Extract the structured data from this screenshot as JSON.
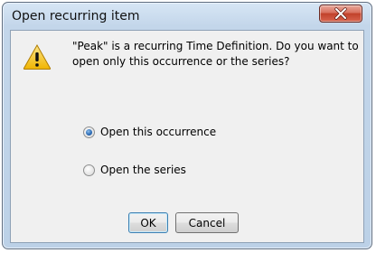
{
  "dialog": {
    "title": "Open recurring item",
    "message": "\"Peak\" is a recurring Time Definition.  Do you want to open only this occurrence or the series?",
    "icon": "warning-icon",
    "close_icon": "close-icon"
  },
  "options": [
    {
      "label": "Open this occurrence",
      "checked": true
    },
    {
      "label": "Open the series",
      "checked": false
    }
  ],
  "buttons": {
    "ok": "OK",
    "cancel": "Cancel"
  },
  "colors": {
    "close_button": "#c1412a",
    "warning_fill": "#f4c21b",
    "client_background": "#f0f0f0"
  }
}
